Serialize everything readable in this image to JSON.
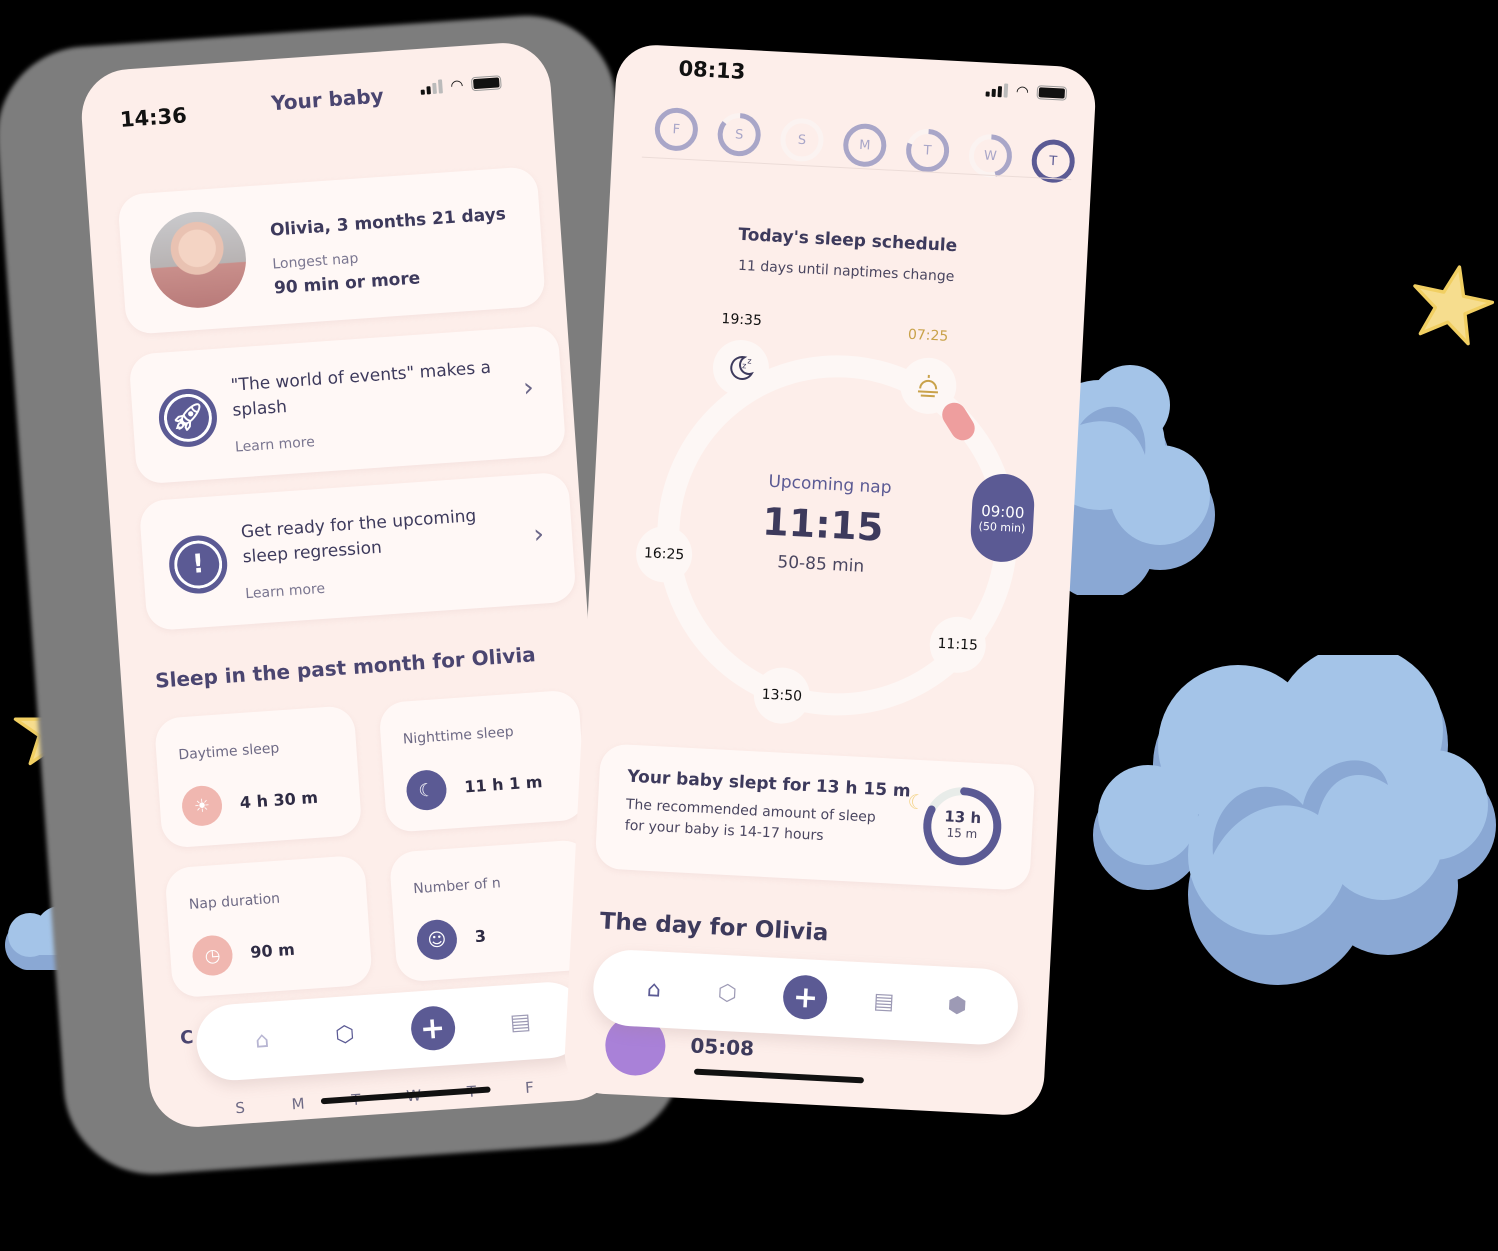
{
  "left_phone": {
    "status_time": "14:36",
    "page_title": "Your baby",
    "profile": {
      "name": "Olivia, 3 months 21 days",
      "sub_label": "Longest nap",
      "sub_value": "90 min or more"
    },
    "info_cards": [
      {
        "icon": "rocket-icon",
        "title": "\"The world of events\" makes a splash",
        "link": "Learn more"
      },
      {
        "icon": "alert-icon",
        "title": "Get ready for the upcoming sleep regression",
        "link": "Learn more"
      }
    ],
    "section_title": "Sleep in the past month for Olivia",
    "stats": [
      {
        "label": "Daytime sleep",
        "value": "4 h 30 m",
        "icon": "sunrise-icon",
        "color": "#f0b7b0"
      },
      {
        "label": "Nighttime sleep",
        "value": "11 h 1 m",
        "icon": "moon-zzz-icon",
        "color": "#5b5a94"
      },
      {
        "label": "Nap duration",
        "value": "90 m",
        "icon": "clock-icon",
        "color": "#f0b7b0"
      },
      {
        "label": "Number of n",
        "value": "3",
        "icon": "sleepy-face-icon",
        "color": "#5b5a94"
      }
    ],
    "partial_section_initial": "C",
    "week_days": [
      "S",
      "M",
      "T",
      "W",
      "T",
      "F"
    ],
    "nav": {
      "plus": "+"
    }
  },
  "right_phone": {
    "status_time": "08:13",
    "week": [
      {
        "label": "F",
        "progress": 1.0,
        "active": false
      },
      {
        "label": "S",
        "progress": 0.85,
        "active": false
      },
      {
        "label": "S",
        "progress": 0.0,
        "active": false
      },
      {
        "label": "M",
        "progress": 1.0,
        "active": false
      },
      {
        "label": "T",
        "progress": 0.8,
        "active": false
      },
      {
        "label": "W",
        "progress": 0.45,
        "active": false
      },
      {
        "label": "T",
        "progress": 1.0,
        "active": true
      }
    ],
    "schedule_title": "Today's sleep schedule",
    "schedule_subtitle": "11 days until naptimes change",
    "bedtime": "19:35",
    "wake_time": "07:25",
    "active_nap": {
      "time": "09:00",
      "duration": "(50 min)"
    },
    "nap_times": [
      "11:15",
      "13:50",
      "16:25"
    ],
    "upcoming_label": "Upcoming nap",
    "upcoming_time": "11:15",
    "upcoming_range": "50-85 min",
    "summary": {
      "title": "Your baby slept for 13 h 15 m",
      "text": "The recommended amount of sleep for your baby is 14-17 hours",
      "donut_hours": "13 h",
      "donut_minutes": "15 m",
      "progress": 0.82
    },
    "day_title": "The day for Olivia",
    "event_time": "05:08",
    "nav": {
      "plus": "+"
    }
  },
  "colors": {
    "primary": "#5b5a94",
    "background": "#fdeeea",
    "card": "#fff8f6",
    "pink": "#f0b7b0",
    "wake": "#c9a24a",
    "cloud": "#a4c4e8",
    "cloud_shadow": "#8aa8d4",
    "star": "#f6dd8e"
  }
}
